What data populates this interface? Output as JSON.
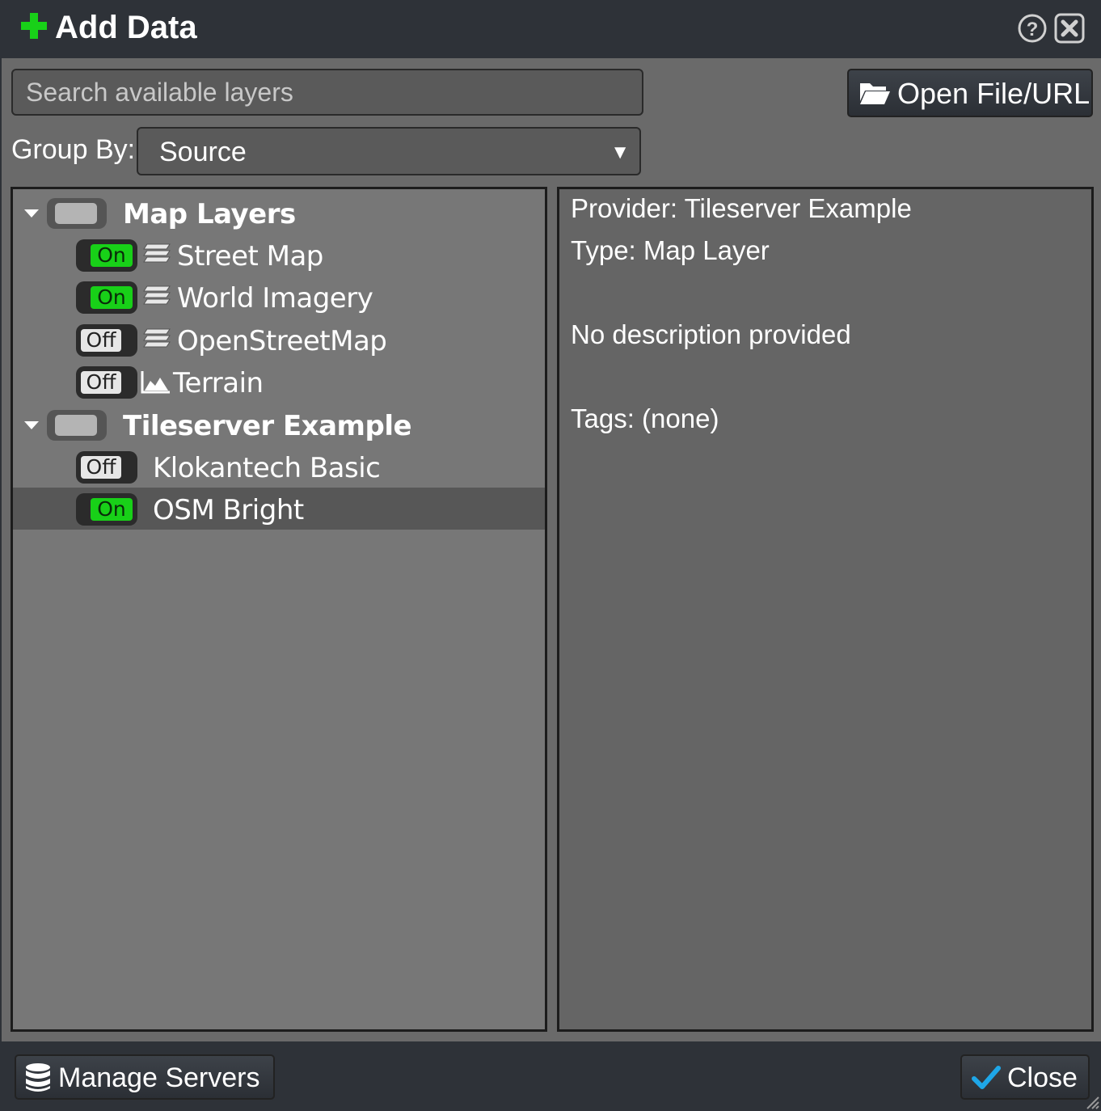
{
  "dialog": {
    "title": "Add Data",
    "icons": {
      "title": "plus-icon",
      "help": "question-circle-icon",
      "close": "close-box-icon"
    },
    "colors": {
      "accent_green": "#18d018",
      "background": "#2e3238",
      "panel": "#777777",
      "check_blue": "#1ea7e8"
    }
  },
  "search": {
    "placeholder": "Search available layers",
    "value": ""
  },
  "open_button": {
    "label": "Open File/URL",
    "icon": "folder-open-icon"
  },
  "group_by": {
    "label": "Group By:",
    "selected": "Source"
  },
  "tree": {
    "groups": [
      {
        "label": "Map Layers",
        "expanded": true,
        "layers": [
          {
            "label": "Street Map",
            "state": "On",
            "icon": "layers-stack-icon"
          },
          {
            "label": "World Imagery",
            "state": "On",
            "icon": "layers-stack-icon"
          },
          {
            "label": "OpenStreetMap",
            "state": "Off",
            "icon": "layers-stack-icon"
          },
          {
            "label": "Terrain",
            "state": "Off",
            "icon": "terrain-chart-icon"
          }
        ]
      },
      {
        "label": "Tileserver Example",
        "expanded": true,
        "layers": [
          {
            "label": "Klokantech Basic",
            "state": "Off",
            "icon": ""
          },
          {
            "label": "OSM Bright",
            "state": "On",
            "icon": "",
            "selected": true
          }
        ]
      }
    ]
  },
  "details": {
    "provider": "Provider: Tileserver Example",
    "type": "Type: Map Layer",
    "description": "No description provided",
    "tags": "Tags: (none)"
  },
  "footer": {
    "manage_label": "Manage Servers",
    "manage_icon": "database-icon",
    "close_label": "Close",
    "close_icon": "checkmark-icon"
  }
}
